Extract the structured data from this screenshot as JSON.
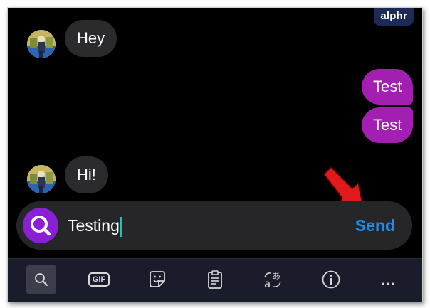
{
  "watermark": "alphr",
  "messages": [
    {
      "text": "Hey",
      "direction": "incoming"
    },
    {
      "text": "Test",
      "direction": "outgoing"
    },
    {
      "text": "Test",
      "direction": "outgoing"
    },
    {
      "text": "Hi!",
      "direction": "incoming"
    }
  ],
  "composer": {
    "input_value": "Testing",
    "send_label": "Send"
  },
  "toolbar": {
    "items": [
      "search-icon",
      "gif-icon",
      "sticker-icon",
      "clipboard-icon",
      "translate-icon",
      "info-icon",
      "more-icon"
    ],
    "gif_label": "GIF",
    "more_label": "…"
  },
  "colors": {
    "outgoing_bubble": "#a21fb2",
    "incoming_bubble": "#2b2b2d",
    "send": "#1e8ce8",
    "search_button": "#8b1fd6",
    "annotation_arrow": "#e0191b"
  }
}
